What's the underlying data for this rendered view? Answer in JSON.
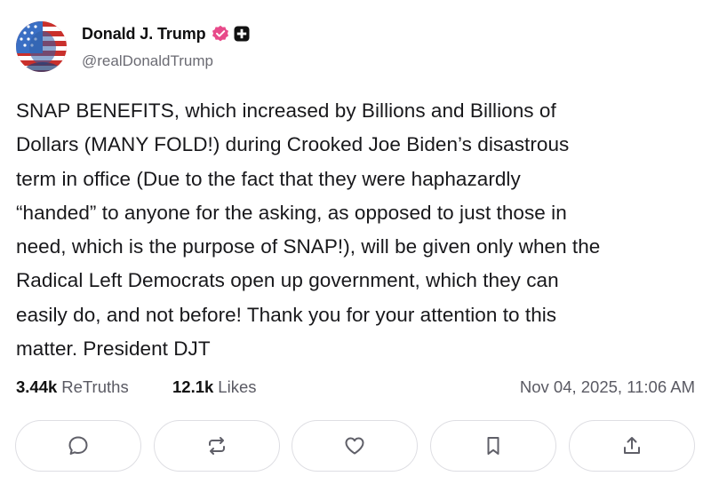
{
  "author": {
    "display_name": "Donald J. Trump",
    "handle": "@realDonaldTrump",
    "verified_badge_color": "#e84a8a",
    "avatar_icon": "avatar-portrait-flag"
  },
  "post": {
    "text": "SNAP BENEFITS, which increased by Billions and Billions of\nDollars (MANY FOLD!) during Crooked Joe Biden’s disastrous\nterm in office (Due to the fact that they were haphazardly\n“handed” to anyone for the asking, as opposed to just those in\nneed, which is the purpose of SNAP!), will be given only when the\nRadical Left Democrats open up government, which they can\neasily do, and not before! Thank you for your attention to this\nmatter. President DJT"
  },
  "stats": {
    "retruths_count": "3.44k",
    "retruths_label": "ReTruths",
    "likes_count": "12.1k",
    "likes_label": "Likes",
    "timestamp": "Nov 04, 2025, 11:06 AM"
  },
  "actions": [
    {
      "name": "reply",
      "icon": "comment-icon"
    },
    {
      "name": "retruth",
      "icon": "repost-icon"
    },
    {
      "name": "like",
      "icon": "heart-icon"
    },
    {
      "name": "bookmark",
      "icon": "bookmark-icon"
    },
    {
      "name": "share",
      "icon": "share-icon"
    }
  ],
  "colors": {
    "text": "#18181b",
    "muted": "#5a5a63",
    "button_border": "#dedee3",
    "icon": "#5f5f68"
  }
}
